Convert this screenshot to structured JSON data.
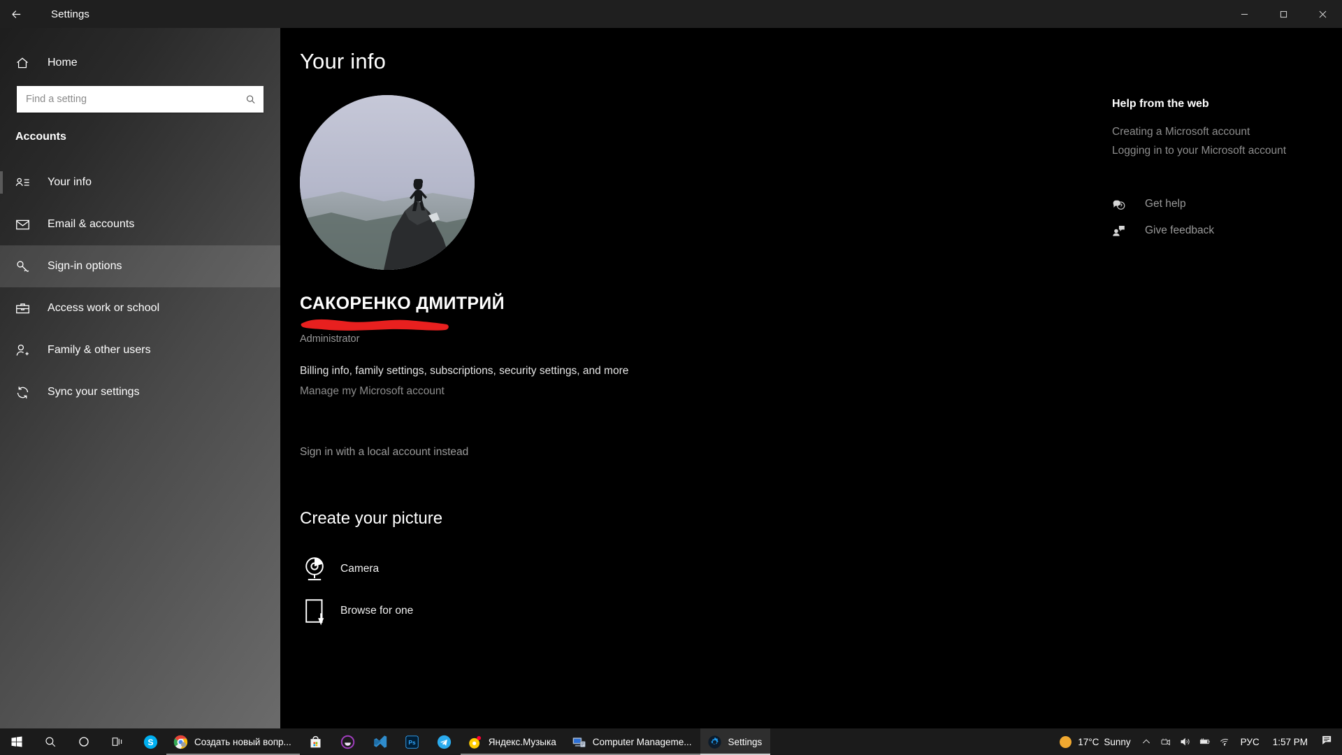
{
  "window": {
    "title": "Settings",
    "back_icon": "back-arrow-icon",
    "minimize_label": "Minimize",
    "maximize_label": "Maximize",
    "close_label": "Close"
  },
  "sidebar": {
    "home": {
      "label": "Home",
      "icon": "home-icon"
    },
    "search": {
      "placeholder": "Find a setting",
      "value": "",
      "icon": "search-icon"
    },
    "category": "Accounts",
    "items": [
      {
        "label": "Your info",
        "icon": "user-card-icon",
        "selected": true,
        "hovered": false
      },
      {
        "label": "Email & accounts",
        "icon": "envelope-icon",
        "selected": false,
        "hovered": false
      },
      {
        "label": "Sign-in options",
        "icon": "key-icon",
        "selected": false,
        "hovered": true
      },
      {
        "label": "Access work or school",
        "icon": "briefcase-icon",
        "selected": false,
        "hovered": false
      },
      {
        "label": "Family & other users",
        "icon": "user-plus-icon",
        "selected": false,
        "hovered": false
      },
      {
        "label": "Sync your settings",
        "icon": "sync-icon",
        "selected": false,
        "hovered": false
      }
    ]
  },
  "main": {
    "page_title": "Your info",
    "avatar_alt": "profile-photo-hiker-on-mountain",
    "user_name": "САКОРЕНКО ДМИТРИЙ",
    "redacted_email": "",
    "user_role": "Administrator",
    "billing_line": "Billing info, family settings, subscriptions, security settings, and more",
    "manage_link": "Manage my Microsoft account",
    "local_account_link": "Sign in with a local account instead",
    "create_picture_title": "Create your picture",
    "picture_options": [
      {
        "label": "Camera",
        "icon": "webcam-icon"
      },
      {
        "label": "Browse for one",
        "icon": "browse-file-icon"
      }
    ]
  },
  "help": {
    "title": "Help from the web",
    "links": [
      "Creating a Microsoft account",
      "Logging in to your Microsoft account"
    ],
    "actions": [
      {
        "label": "Get help",
        "icon": "question-chat-icon"
      },
      {
        "label": "Give feedback",
        "icon": "feedback-person-icon"
      }
    ]
  },
  "taskbar": {
    "system_buttons": [
      {
        "name": "start-button",
        "icon": "windows-logo-icon"
      },
      {
        "name": "search-button",
        "icon": "search-icon"
      },
      {
        "name": "cortana-button",
        "icon": "cortana-circle-icon"
      },
      {
        "name": "task-view-button",
        "icon": "task-view-icon"
      }
    ],
    "pinned": [
      {
        "name": "skype",
        "icon": "skype-icon"
      }
    ],
    "tasks": [
      {
        "label": "Создать новый вопр...",
        "icon": "chrome-icon",
        "active": false
      },
      {
        "label": "",
        "icon": "microsoft-store-icon",
        "active": false
      },
      {
        "label": "",
        "icon": "purple-app-icon",
        "active": false
      },
      {
        "label": "",
        "icon": "vscode-icon",
        "active": false
      },
      {
        "label": "",
        "icon": "photoshop-icon",
        "active": false
      },
      {
        "label": "",
        "icon": "telegram-icon",
        "active": false
      },
      {
        "label": "Яндекс.Музыка",
        "icon": "yandex-music-icon",
        "active": false
      },
      {
        "label": "Computer Manageme...",
        "icon": "computer-management-icon",
        "active": false
      },
      {
        "label": "Settings",
        "icon": "settings-gear-icon",
        "active": true
      }
    ],
    "tray": {
      "weather_temp": "17°C",
      "weather_condition": "Sunny",
      "show_hidden_icon": "chevron-up-icon",
      "icons": [
        {
          "name": "camera-privacy-icon"
        },
        {
          "name": "volume-icon"
        },
        {
          "name": "battery-icon"
        },
        {
          "name": "wifi-icon"
        }
      ],
      "language": "РУС",
      "clock": "1:57 PM",
      "notifications_icon": "action-center-icon"
    }
  },
  "colors": {
    "accent": "#5a5a5a",
    "redaction": "#e8201f",
    "taskbar": "#1b1b1b",
    "sun": "#f0a830"
  }
}
